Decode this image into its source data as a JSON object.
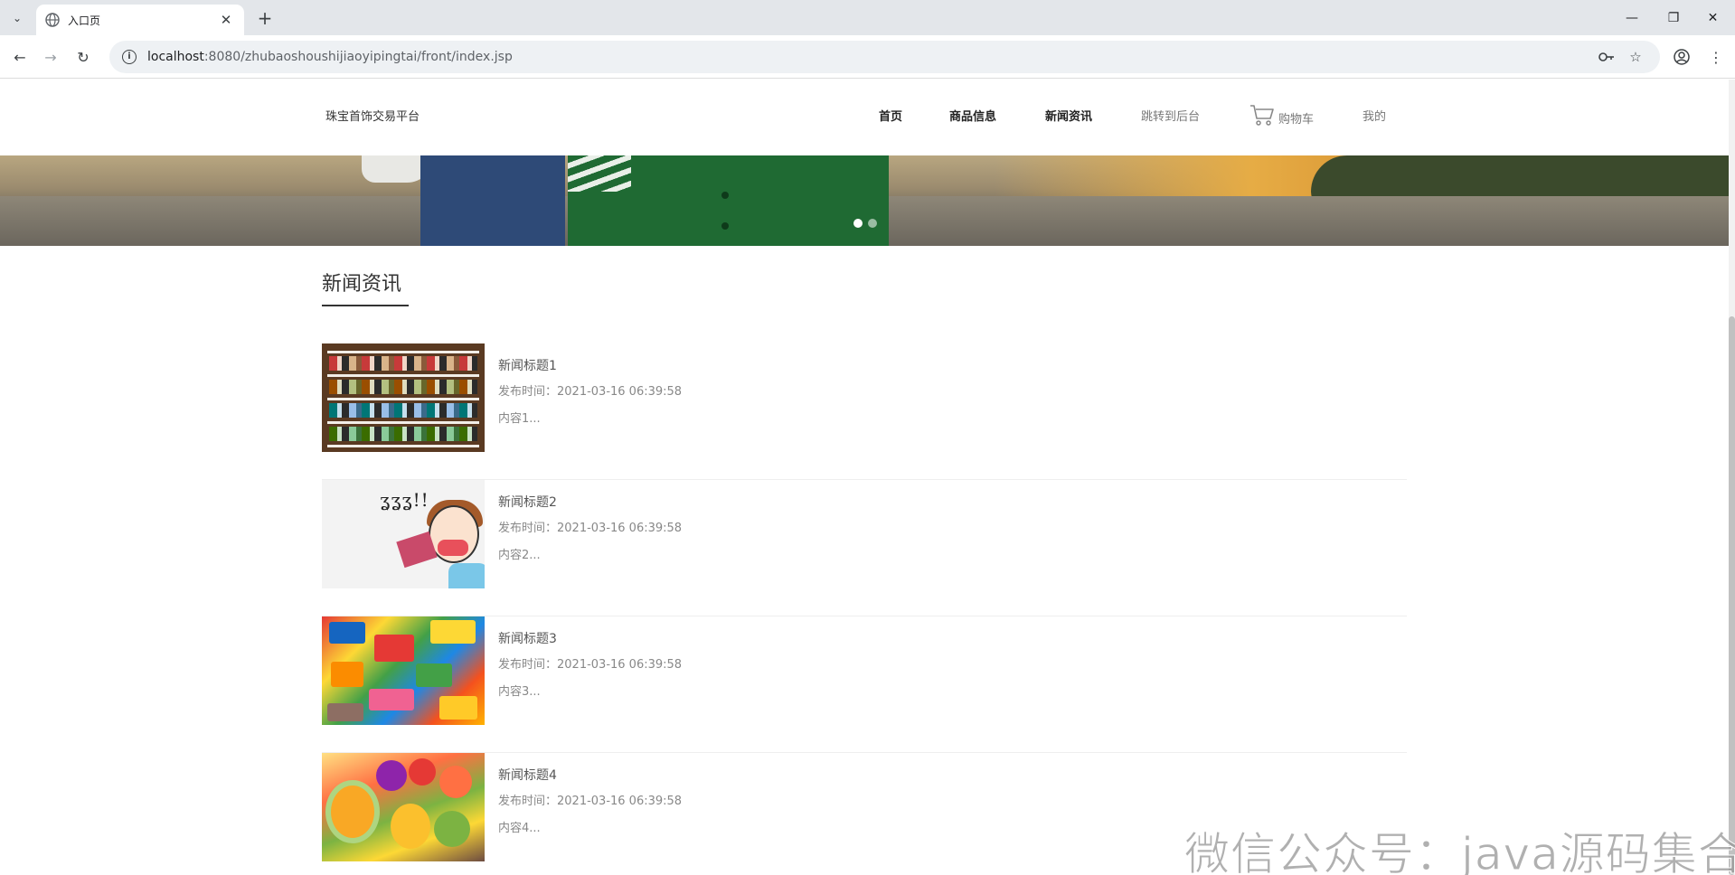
{
  "browser": {
    "tab_title": "入口页",
    "url_host": "localhost",
    "url_path": ":8080/zhubaoshoushijiaoyipingtai/front/index.jsp",
    "minimize": "—",
    "restore": "❐",
    "close": "✕"
  },
  "site": {
    "logo": "珠宝首饰交易平台",
    "nav": {
      "home": "首页",
      "products": "商品信息",
      "news": "新闻资讯",
      "backend": "跳转到后台",
      "cart": "购物车",
      "mine": "我的"
    }
  },
  "banner": {
    "slide_count": 2,
    "active_slide": 1
  },
  "news_section": {
    "title": "新闻资讯",
    "items": [
      {
        "title": "新闻标题1",
        "time": "发布时间：2021-03-16 06:39:58",
        "content": "内容1..."
      },
      {
        "title": "新闻标题2",
        "time": "发布时间：2021-03-16 06:39:58",
        "content": "内容2..."
      },
      {
        "title": "新闻标题3",
        "time": "发布时间：2021-03-16 06:39:58",
        "content": "内容3..."
      },
      {
        "title": "新闻标题4",
        "time": "发布时间：2021-03-16 06:39:58",
        "content": "内容4..."
      }
    ]
  },
  "watermark": "微信公众号：java源码集合",
  "colors": {
    "accent_underline": "#333333",
    "nav_active": "#222222",
    "muted_text": "#888888"
  }
}
